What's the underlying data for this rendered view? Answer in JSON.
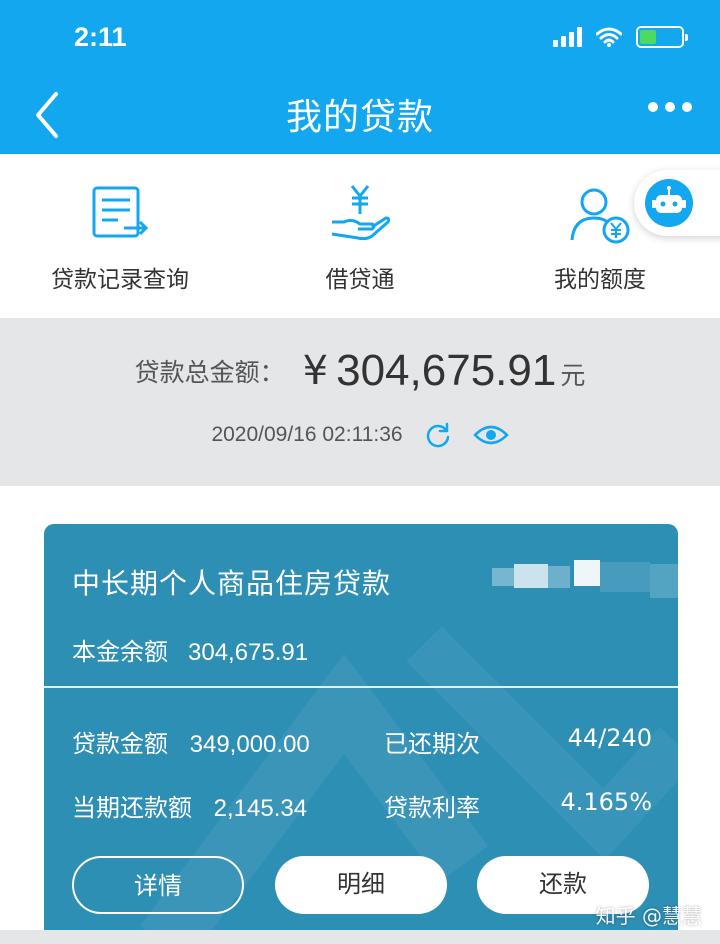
{
  "status_bar": {
    "time": "2:11"
  },
  "header": {
    "title": "我的贷款"
  },
  "quick_menu": {
    "items": [
      {
        "label": "贷款记录查询",
        "icon": "loan-record-icon"
      },
      {
        "label": "借贷通",
        "icon": "hand-yen-icon"
      },
      {
        "label": "我的额度",
        "icon": "user-yen-icon"
      }
    ],
    "robot_icon": "robot-icon"
  },
  "summary": {
    "label": "贷款总金额：",
    "currency_symbol": "¥",
    "amount": "304,675.91",
    "unit": "元",
    "timestamp": "2020/09/16 02:11:36"
  },
  "loan_card": {
    "name": "中长期个人商品住房贷款",
    "principal_label": "本金余额",
    "principal_value": "304,675.91",
    "loan_amount_label": "贷款金额",
    "loan_amount_value": "349,000.00",
    "paid_periods_label": "已还期次",
    "paid_periods_value": "44/240",
    "current_payment_label": "当期还款额",
    "current_payment_value": "2,145.34",
    "rate_label": "贷款利率",
    "rate_value": "4.165%",
    "buttons": {
      "details": "详情",
      "breakdown": "明细",
      "repay": "还款"
    }
  },
  "watermark": "知乎 @慧慧",
  "colors": {
    "primary": "#12a7ee",
    "card": "#2e8fb5",
    "battery": "#4cd964"
  }
}
